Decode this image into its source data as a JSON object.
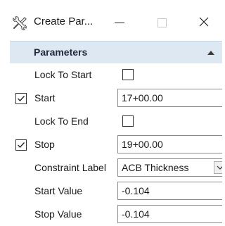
{
  "window": {
    "title": "Create Par...",
    "icon": "tools-icon"
  },
  "section": {
    "title": "Parameters",
    "collapse_icon": "chevron-up-icon",
    "header_color": "#dde8f3"
  },
  "rows": [
    {
      "label": "Lock To Start",
      "row_checked": false,
      "kind": "checkbox",
      "value_checked": false
    },
    {
      "label": "Start",
      "row_checked": true,
      "kind": "text",
      "value": "17+00.00"
    },
    {
      "label": "Lock To End",
      "row_checked": false,
      "kind": "checkbox",
      "value_checked": false
    },
    {
      "label": "Stop",
      "row_checked": true,
      "kind": "text",
      "value": "19+00.00"
    },
    {
      "label": "Constraint Label",
      "row_checked": false,
      "kind": "select",
      "value": "ACB Thickness"
    },
    {
      "label": "Start Value",
      "row_checked": false,
      "kind": "text",
      "value": "-0.104"
    },
    {
      "label": "Stop Value",
      "row_checked": false,
      "kind": "text",
      "value": "-0.104"
    }
  ]
}
